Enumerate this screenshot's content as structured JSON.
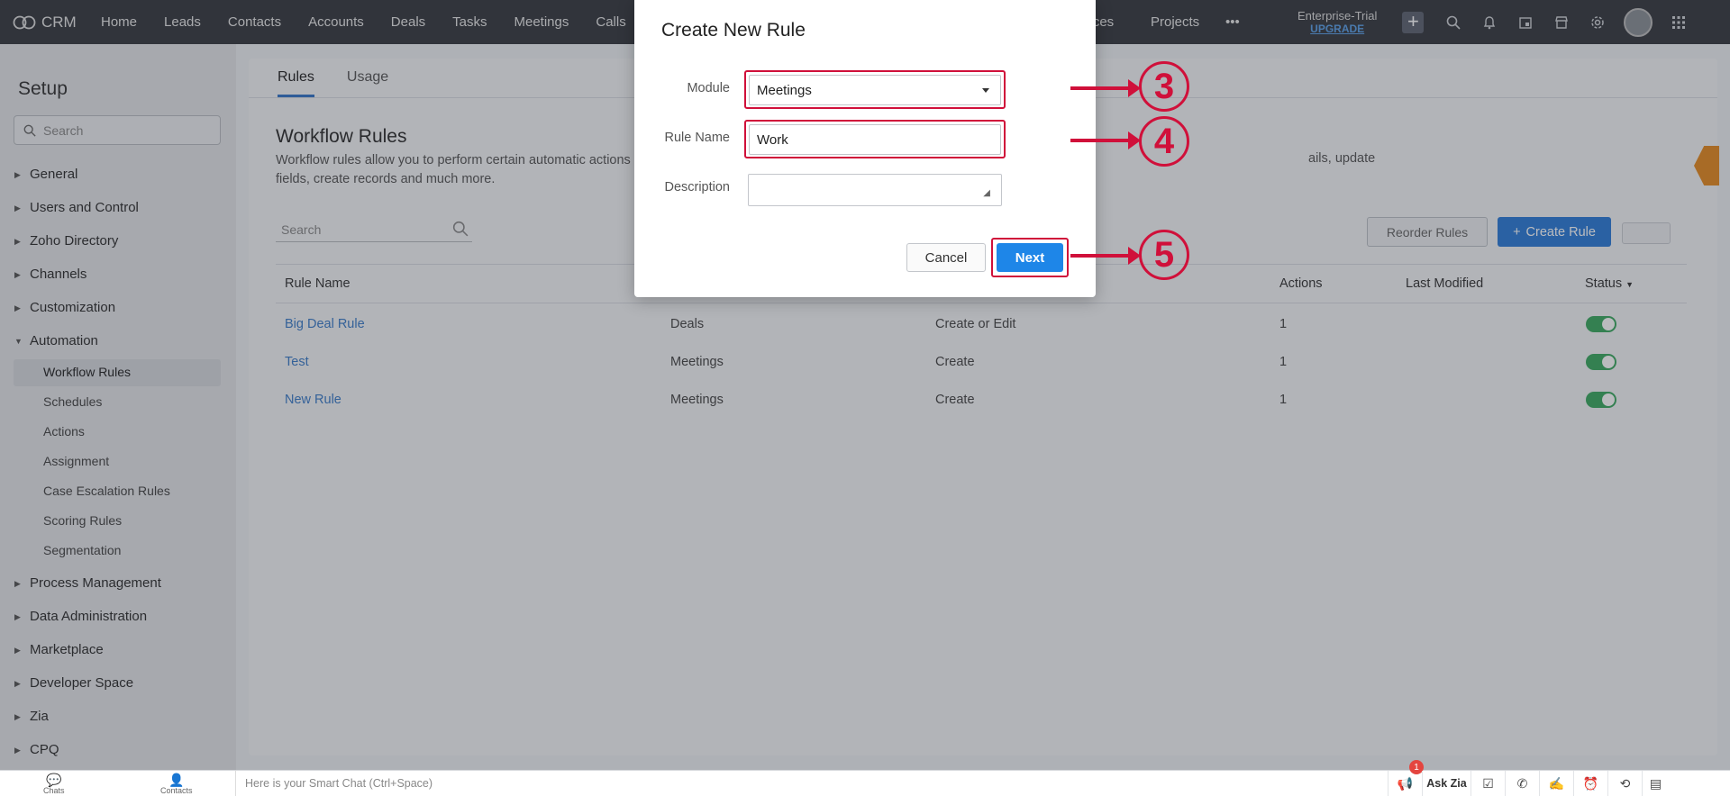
{
  "topnav": {
    "app_name": "CRM",
    "items": [
      "Home",
      "Leads",
      "Contacts",
      "Accounts",
      "Deals",
      "Tasks",
      "Meetings",
      "Calls",
      "vices",
      "Projects"
    ],
    "more": "•••",
    "edition": "Enterprise-Trial",
    "upgrade": "UPGRADE"
  },
  "sidebar": {
    "title": "Setup",
    "search_placeholder": "Search",
    "groups": [
      "General",
      "Users and Control",
      "Zoho Directory",
      "Channels",
      "Customization",
      "Automation"
    ],
    "automation_items": [
      "Workflow Rules",
      "Schedules",
      "Actions",
      "Assignment",
      "Case Escalation Rules",
      "Scoring Rules",
      "Segmentation"
    ],
    "groups_after": [
      "Process Management",
      "Data Administration",
      "Marketplace",
      "Developer Space",
      "Zia",
      "CPQ"
    ]
  },
  "main": {
    "tabs": [
      "Rules",
      "Usage"
    ],
    "title": "Workflow Rules",
    "description": "Workflow rules allow you to perform certain automatic actions",
    "description_end": "ails, update",
    "description_line2": "fields, create records and much more.",
    "search_placeholder": "Search",
    "reorder_label": "Reorder Rules",
    "create_label": "Create Rule",
    "columns": [
      "Rule Name",
      "Actions",
      "Last Modified",
      "Status"
    ],
    "rows": [
      {
        "name": "Big Deal Rule",
        "module": "Deals",
        "trigger": "Create or Edit",
        "actions": "1",
        "status": "on"
      },
      {
        "name": "Test",
        "module": "Meetings",
        "trigger": "Create",
        "actions": "1",
        "status": "on"
      },
      {
        "name": "New Rule",
        "module": "Meetings",
        "trigger": "Create",
        "actions": "1",
        "status": "on"
      }
    ]
  },
  "modal": {
    "title": "Create New Rule",
    "module_label": "Module",
    "module_value": "Meetings",
    "rule_name_label": "Rule Name",
    "rule_name_value": "Work",
    "description_label": "Description",
    "description_value": "",
    "cancel_label": "Cancel",
    "next_label": "Next"
  },
  "annotations": [
    "3",
    "4",
    "5"
  ],
  "bottombar": {
    "chats": "Chats",
    "contacts": "Contacts",
    "smartchat": "Here is your Smart Chat (Ctrl+Space)",
    "badge": "1",
    "askzia": "Ask Zia"
  },
  "colors": {
    "highlight": "#d0103a",
    "primary": "#1e86e8",
    "nav_bg": "#35393f"
  }
}
